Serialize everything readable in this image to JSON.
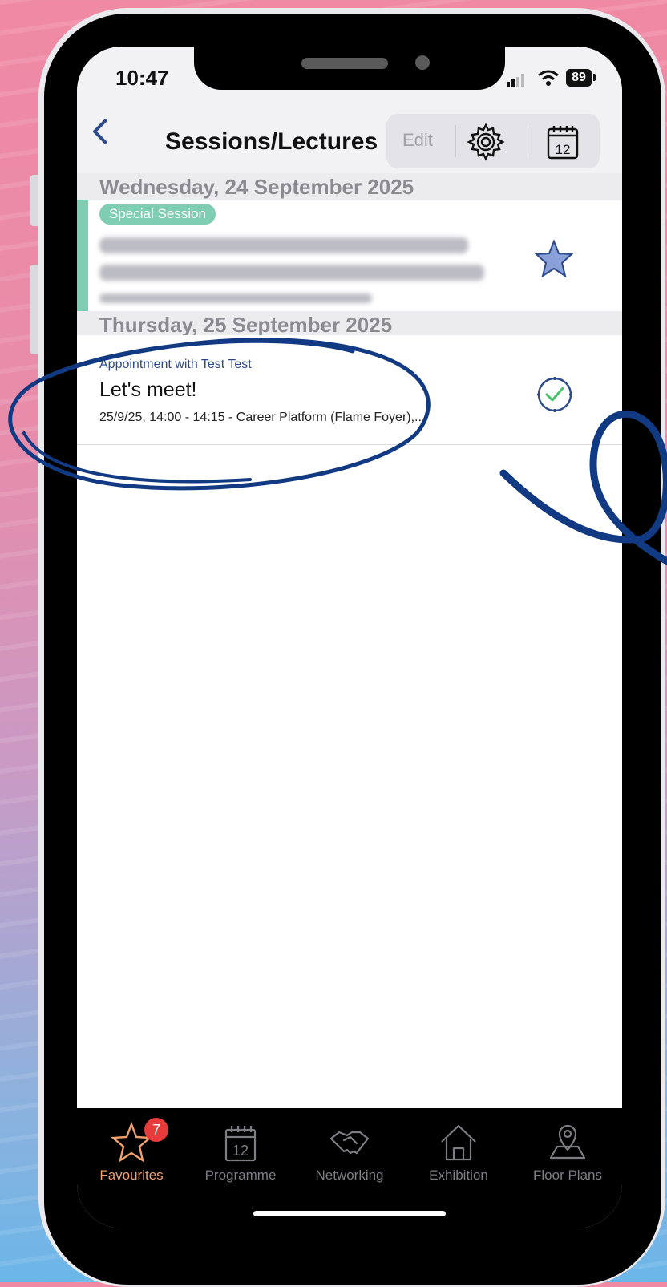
{
  "status_bar": {
    "time": "10:47",
    "battery": "89"
  },
  "nav": {
    "title": "Sessions/Lectures",
    "edit_label": "Edit",
    "calendar_day": "12"
  },
  "sections": [
    {
      "date": "Wednesday, 24 September 2025",
      "items": [
        {
          "tag": "Special Session",
          "title": "(blurred)",
          "favorite": true
        }
      ]
    },
    {
      "date": "Thursday, 25 September 2025",
      "items": [
        {
          "subtitle": "Appointment with Test Test",
          "title": "Let's meet!",
          "detail": "25/9/25, 14:00 - 14:15 - Career Platform (Flame Foyer),..."
        }
      ]
    }
  ],
  "tabs": [
    {
      "label": "Favourites",
      "icon": "star-icon",
      "badge": "7",
      "active": true
    },
    {
      "label": "Programme",
      "icon": "calendar-icon",
      "day": "12"
    },
    {
      "label": "Networking",
      "icon": "handshake-icon"
    },
    {
      "label": "Exhibition",
      "icon": "house-icon"
    },
    {
      "label": "Floor Plans",
      "icon": "map-pin-icon"
    }
  ],
  "colors": {
    "accent_teal": "#7fcdb3",
    "brand_blue": "#1e3f8f",
    "active_tab": "#f0a06c",
    "badge_red": "#e83b3b"
  }
}
